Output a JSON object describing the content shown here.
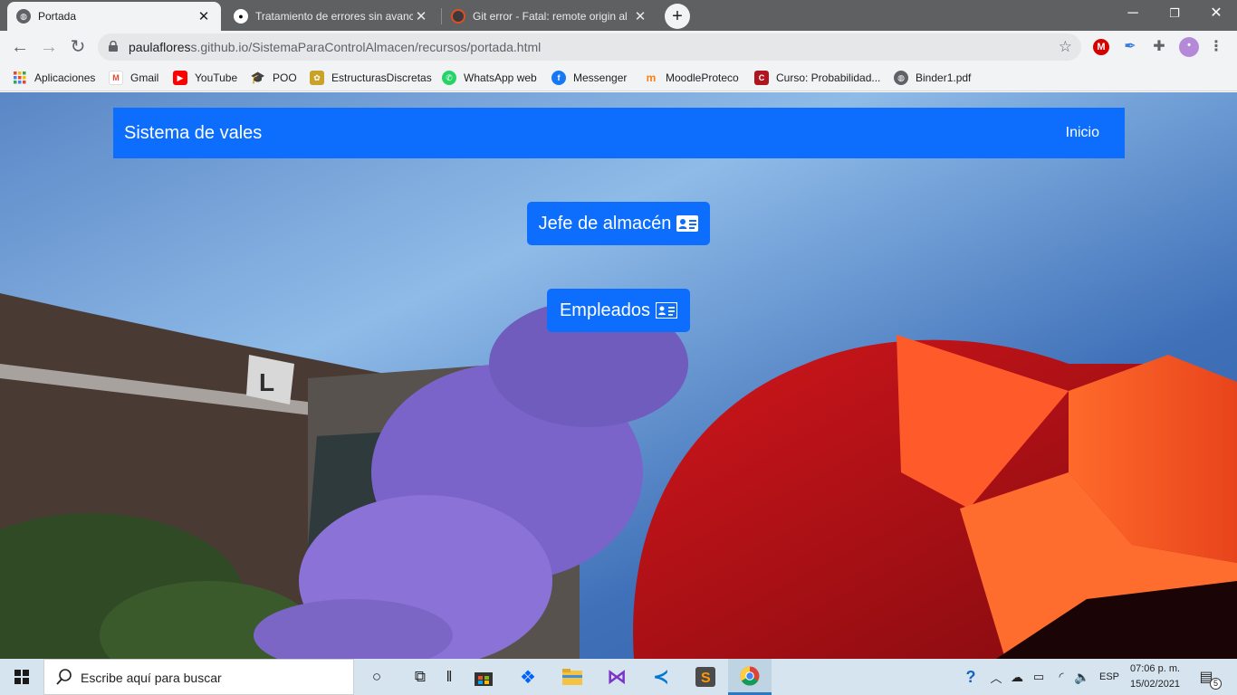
{
  "tabs": [
    {
      "title": "Portada",
      "active": true
    },
    {
      "title": "Tratamiento de errores sin avanc",
      "active": false
    },
    {
      "title": "Git error - Fatal: remote origin al",
      "active": false
    }
  ],
  "toolbar": {
    "url_host": "paulaflores",
    "url_rest": "s.github.io/SistemaParaControlAlmacen/recursos/portada.html"
  },
  "bookmarks": [
    {
      "label": "Aplicaciones",
      "icon": "apps-grid-icon"
    },
    {
      "label": "Gmail",
      "icon": "gmail-icon"
    },
    {
      "label": "YouTube",
      "icon": "youtube-icon"
    },
    {
      "label": "POO",
      "icon": "graduation-cap-icon"
    },
    {
      "label": "EstructurasDiscretas",
      "icon": "site-icon"
    },
    {
      "label": "WhatsApp web",
      "icon": "whatsapp-icon"
    },
    {
      "label": "Messenger",
      "icon": "facebook-icon"
    },
    {
      "label": "MoodleProteco",
      "icon": "moodle-icon"
    },
    {
      "label": "Curso: Probabilidad...",
      "icon": "course-icon"
    },
    {
      "label": "Binder1.pdf",
      "icon": "globe-icon"
    }
  ],
  "page": {
    "brand": "Sistema de vales",
    "nav_link": "Inicio",
    "buttons": [
      "Jefe de almacén",
      "Empleados"
    ],
    "primary_color": "#0d6efd"
  },
  "taskbar": {
    "search_placeholder": "Escribe aquí para buscar",
    "language": "ESP",
    "time": "07:06 p. m.",
    "date": "15/02/2021",
    "notification_count": "5"
  }
}
